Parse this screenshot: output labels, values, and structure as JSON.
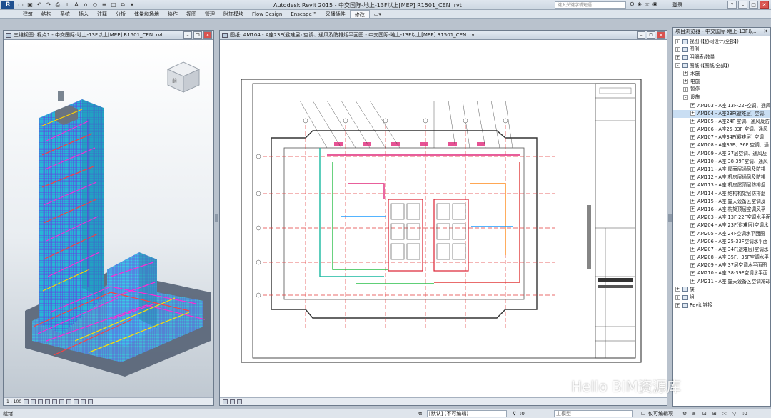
{
  "app": {
    "title": "Autodesk Revit 2015 -     中交国际-地上-13F以上[MEP] R1501_CEN .rvt",
    "search_placeholder": "键入关键字或短语",
    "login": "登录",
    "logo": "R"
  },
  "ribbon": {
    "tabs": [
      "建筑",
      "结构",
      "系统",
      "插入",
      "注释",
      "分析",
      "体量和场地",
      "协作",
      "视图",
      "管理",
      "附加模块",
      "Flow Design",
      "Enscape™",
      "采播插件",
      "修改"
    ],
    "active": "修改"
  },
  "view3d": {
    "title": "三维视图: 视点1 - 中交国际-地上-13F以上[MEP] R1501_CEN .rvt",
    "scale": "1 : 100",
    "viewcube_label": "前"
  },
  "sheet": {
    "title": "图纸: AM104 - A座23F(避难层) 空调、通风及防排烟平面图 - 中交国际-地上-13F以上[MEP] R1501_CEN .rvt"
  },
  "browser": {
    "title": "项目浏览器 - 中交国际-地上-13F以...",
    "items": [
      {
        "level": 0,
        "toggle": "+",
        "label": "视图 (【协同设计/全部】)"
      },
      {
        "level": 0,
        "toggle": "+",
        "label": "图例"
      },
      {
        "level": 0,
        "toggle": "+",
        "label": "明细表/数量"
      },
      {
        "level": 0,
        "toggle": "-",
        "label": "图纸 (【图纸/全部】)"
      },
      {
        "level": 1,
        "toggle": "+",
        "label": "水施"
      },
      {
        "level": 1,
        "toggle": "+",
        "label": "电施"
      },
      {
        "level": 1,
        "toggle": "+",
        "label": "暂停"
      },
      {
        "level": 1,
        "toggle": "-",
        "label": "设施"
      },
      {
        "level": 2,
        "toggle": "+",
        "label": "AM103 - A座 13F-22F空调、通风"
      },
      {
        "level": 2,
        "toggle": "+",
        "label": "AM104 - A座23F(避难层) 空调、",
        "selected": true
      },
      {
        "level": 2,
        "toggle": "+",
        "label": "AM105 - A座24F 空调、通风及防"
      },
      {
        "level": 2,
        "toggle": "+",
        "label": "AM106 - A座25-33F 空调、通风"
      },
      {
        "level": 2,
        "toggle": "+",
        "label": "AM107 - A座34F(避难层) 空调"
      },
      {
        "level": 2,
        "toggle": "+",
        "label": "AM108 - A座35F、36F 空调、通"
      },
      {
        "level": 2,
        "toggle": "+",
        "label": "AM109 - A座 37层空调、通风及"
      },
      {
        "level": 2,
        "toggle": "+",
        "label": "AM110 - A座 38-39F空调、通风"
      },
      {
        "level": 2,
        "toggle": "+",
        "label": "AM111 - A座 屋面层通风及防排"
      },
      {
        "level": 2,
        "toggle": "+",
        "label": "AM112 - A座 机房层通风及防排"
      },
      {
        "level": 2,
        "toggle": "+",
        "label": "AM113 - A座 机房屋顶层防排烟"
      },
      {
        "level": 2,
        "toggle": "+",
        "label": "AM114 - A座 结构构架层防排烟"
      },
      {
        "level": 2,
        "toggle": "+",
        "label": "AM115 - A座 露天设备区空调及"
      },
      {
        "level": 2,
        "toggle": "+",
        "label": "AM116 - A座 构架顶层空调风平"
      },
      {
        "level": 2,
        "toggle": "+",
        "label": "AM203 - A座 13F-22F空调水平面"
      },
      {
        "level": 2,
        "toggle": "+",
        "label": "AM204 - A座 23F(避难层)空调水"
      },
      {
        "level": 2,
        "toggle": "+",
        "label": "AM205 - A座 24F空调水平面图"
      },
      {
        "level": 2,
        "toggle": "+",
        "label": "AM206 - A座 25-33F空调水平面"
      },
      {
        "level": 2,
        "toggle": "+",
        "label": "AM207 - A座 34F(避难层)空调水"
      },
      {
        "level": 2,
        "toggle": "+",
        "label": "AM208 - A座 35F、36F空调水平"
      },
      {
        "level": 2,
        "toggle": "+",
        "label": "AM209 - A座 37层空调水平面图"
      },
      {
        "level": 2,
        "toggle": "+",
        "label": "AM210 - A座 38-39F空调水平面"
      },
      {
        "level": 2,
        "toggle": "+",
        "label": "AM211 - A座 露天设备区空调冷却"
      },
      {
        "level": 0,
        "toggle": "+",
        "label": "族"
      },
      {
        "level": 0,
        "toggle": "+",
        "label": "组"
      },
      {
        "level": 0,
        "toggle": "+",
        "label": "Revit 链接"
      }
    ]
  },
  "status": {
    "left": "就绪",
    "workset": "[默认] (不可编辑)",
    "count": ":0",
    "model": "主模型",
    "editable_only": "仅可编辑项"
  },
  "watermark": "Hello BIM资源库"
}
